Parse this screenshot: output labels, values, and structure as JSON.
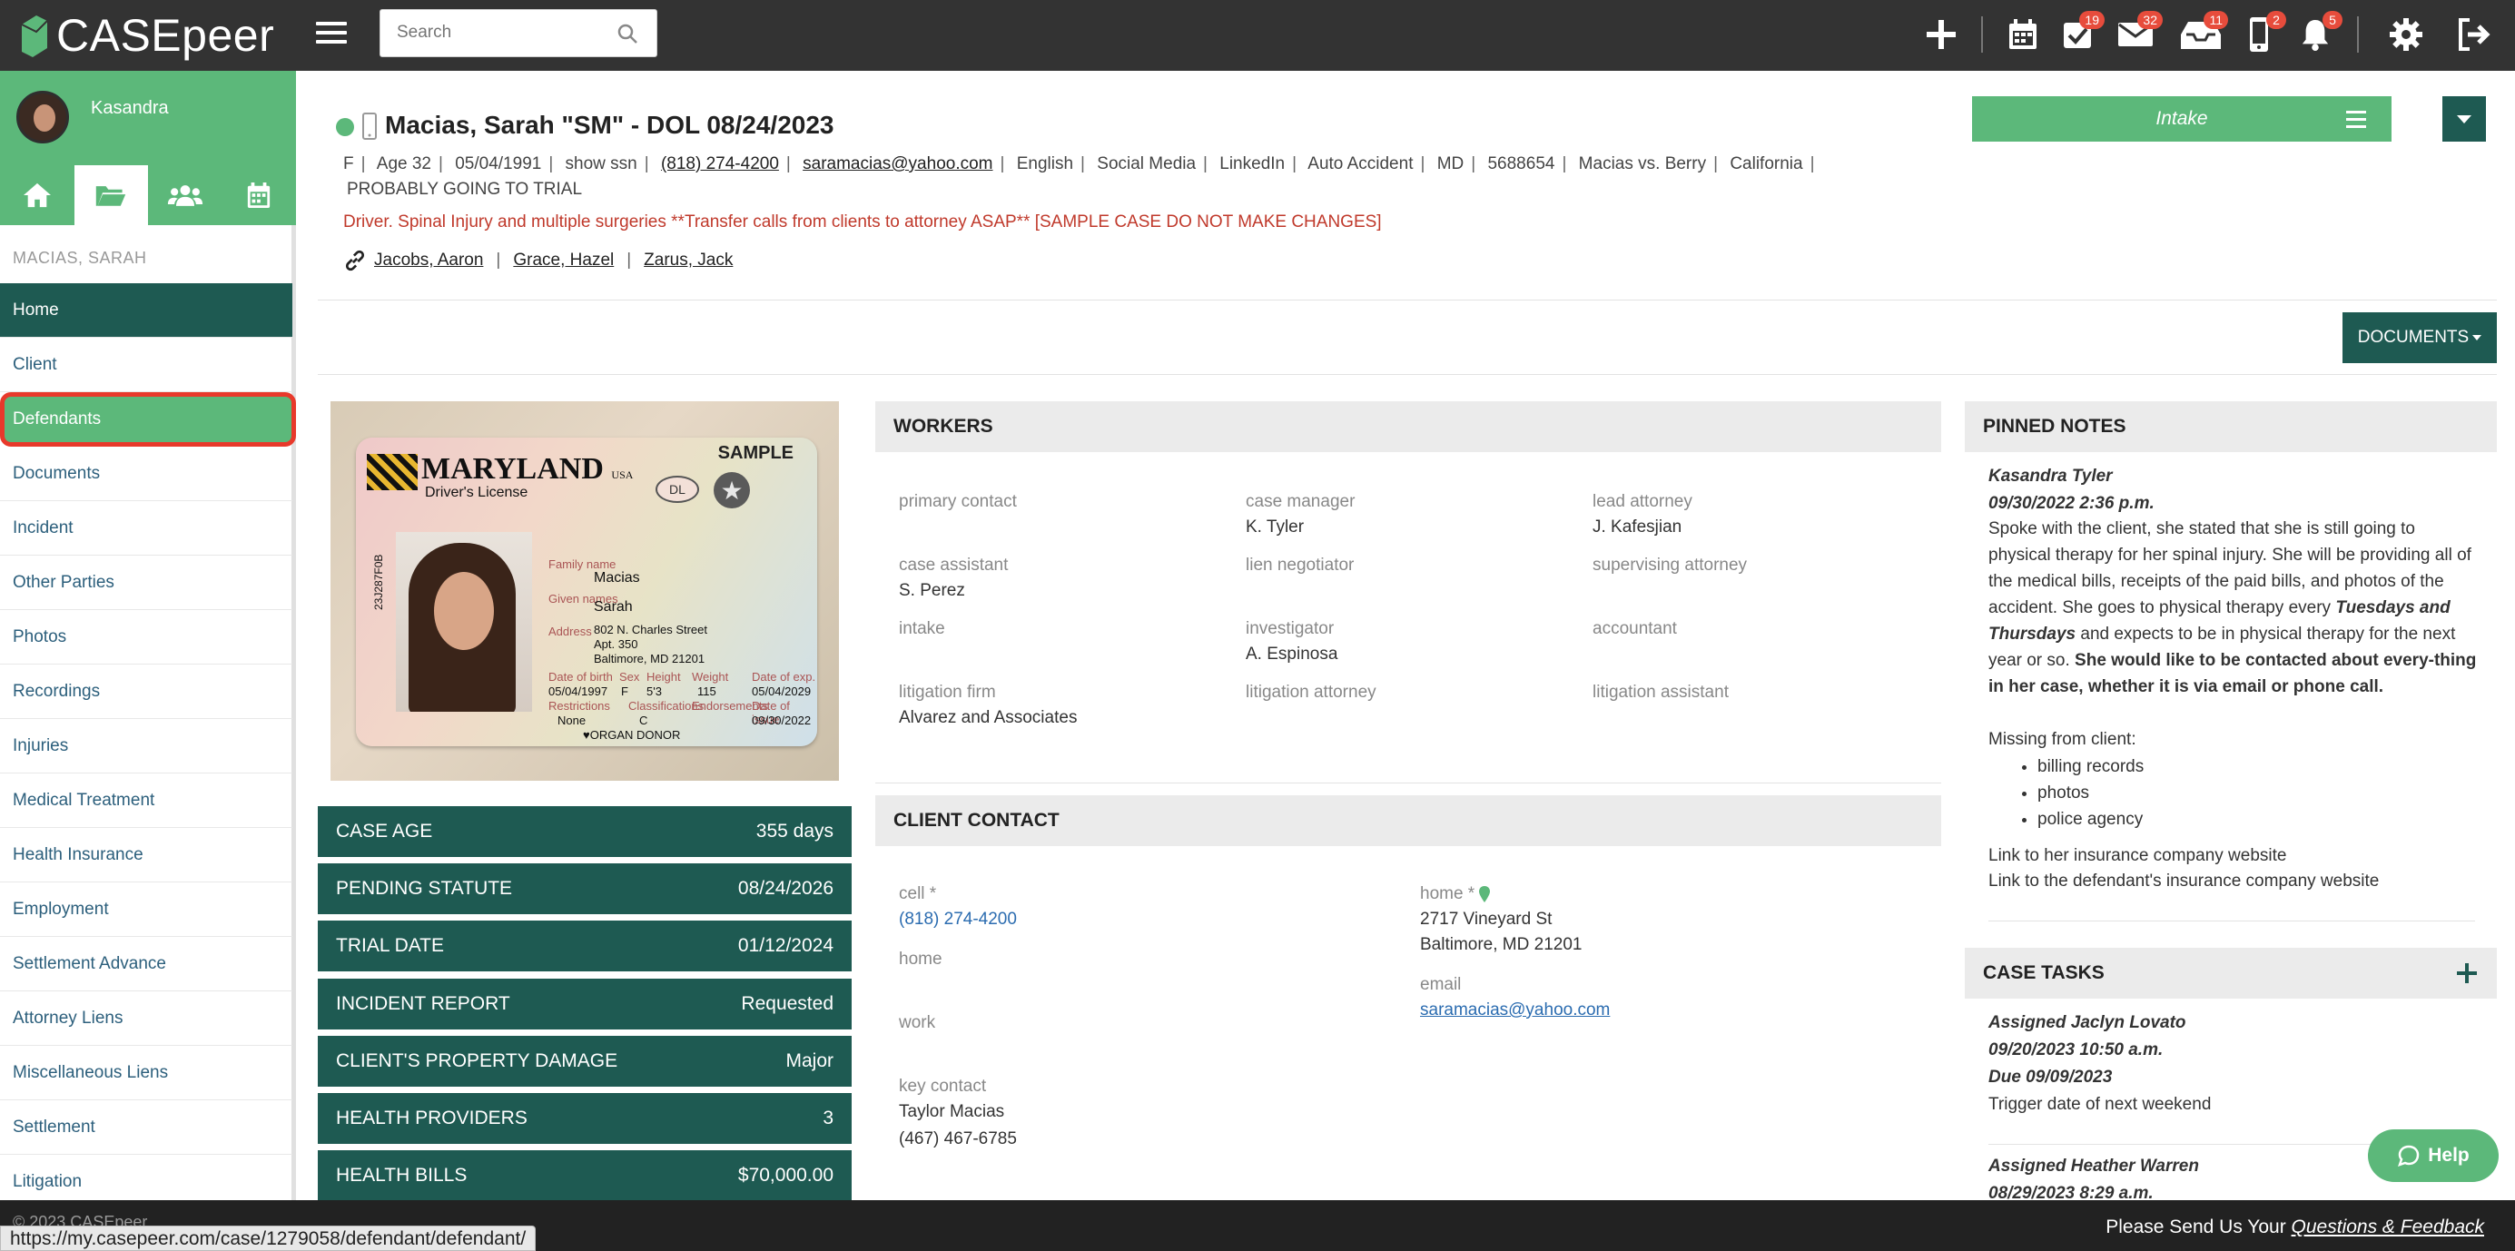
{
  "app": {
    "logo_text": "CASEpeer",
    "search_placeholder": "Search",
    "badges": {
      "tasks": "19",
      "mail": "32",
      "inbox": "11",
      "phone": "2",
      "bell": "5"
    }
  },
  "sidebar": {
    "username": "Kasandra",
    "case_name": "MACIAS, SARAH",
    "items": [
      {
        "label": "Home"
      },
      {
        "label": "Client"
      },
      {
        "label": "Defendants"
      },
      {
        "label": "Documents"
      },
      {
        "label": "Incident"
      },
      {
        "label": "Other Parties"
      },
      {
        "label": "Photos"
      },
      {
        "label": "Recordings"
      },
      {
        "label": "Injuries"
      },
      {
        "label": "Medical Treatment"
      },
      {
        "label": "Health Insurance"
      },
      {
        "label": "Employment"
      },
      {
        "label": "Settlement Advance"
      },
      {
        "label": "Attorney Liens"
      },
      {
        "label": "Miscellaneous Liens"
      },
      {
        "label": "Settlement"
      },
      {
        "label": "Litigation"
      }
    ]
  },
  "case": {
    "title": "Macias, Sarah \"SM\" - DOL 08/24/2023",
    "info": [
      "F",
      "Age 32",
      "05/04/1991",
      "show ssn",
      "(818) 274-4200",
      "saramacias@yahoo.com",
      "English",
      "Social Media",
      "LinkedIn",
      "Auto Accident",
      "MD",
      "5688654",
      "Macias vs. Berry",
      "California"
    ],
    "info2": "PROBABLY GOING TO TRIAL",
    "alert": "Driver. Spinal Injury and multiple surgeries **Transfer calls from clients to attorney ASAP** [SAMPLE CASE DO NOT MAKE CHANGES]",
    "related": [
      "Jacobs, Aaron",
      "Grace, Hazel",
      "Zarus, Jack"
    ],
    "phase_button": "Intake",
    "documents_button": "DOCUMENTS"
  },
  "license": {
    "state": "MARYLAND",
    "usa": "USA",
    "sub": "Driver's License",
    "sample": "SAMPLE",
    "dl": "DL",
    "number": "23J287F0B",
    "family_name_label": "Family name",
    "family_name": "Macias",
    "given_names_label": "Given names",
    "given_name": "Sarah",
    "address_label": "Address",
    "address1": "802 N. Charles Street",
    "address2": "Apt. 350",
    "address3": "Baltimore, MD 21201",
    "dob_label": "Date of birth",
    "dob": "05/04/1997",
    "sex_label": "Sex",
    "sex": "F",
    "height_label": "Height",
    "height": "5'3",
    "weight_label": "Weight",
    "weight": "115",
    "expiry_label": "Date of exp.",
    "expiry": "05/04/2029",
    "restrictions_label": "Restrictions",
    "restrictions": "None",
    "class_label": "Classifications",
    "class": "C",
    "endorse_label": "Endorsements",
    "issue_label": "Date of issue",
    "issue": "09/30/2022",
    "donor": "ORGAN DONOR"
  },
  "stats": [
    {
      "label": "CASE AGE",
      "value": "355 days"
    },
    {
      "label": "PENDING STATUTE",
      "value": "08/24/2026"
    },
    {
      "label": "TRIAL DATE",
      "value": "01/12/2024"
    },
    {
      "label": "INCIDENT REPORT",
      "value": "Requested"
    },
    {
      "label": "CLIENT'S PROPERTY DAMAGE",
      "value": "Major"
    },
    {
      "label": "HEALTH PROVIDERS",
      "value": "3"
    },
    {
      "label": "HEALTH BILLS",
      "value": "$70,000.00"
    }
  ],
  "workers": {
    "heading": "WORKERS",
    "items": [
      {
        "label": "primary contact",
        "value": ""
      },
      {
        "label": "case manager",
        "value": "K. Tyler"
      },
      {
        "label": "lead attorney",
        "value": "J. Kafesjian"
      },
      {
        "label": "case assistant",
        "value": "S. Perez"
      },
      {
        "label": "lien negotiator",
        "value": ""
      },
      {
        "label": "supervising attorney",
        "value": ""
      },
      {
        "label": "intake",
        "value": ""
      },
      {
        "label": "investigator",
        "value": "A. Espinosa"
      },
      {
        "label": "accountant",
        "value": ""
      },
      {
        "label": "litigation firm",
        "value": "Alvarez and Associates"
      },
      {
        "label": "litigation attorney",
        "value": ""
      },
      {
        "label": "litigation assistant",
        "value": ""
      }
    ]
  },
  "client_contact": {
    "heading": "CLIENT CONTACT",
    "cell_label": "cell *",
    "cell": "(818) 274-4200",
    "home_label": "home",
    "work_label": "work",
    "key_contact_label": "key contact",
    "key_contact_name": "Taylor Macias",
    "key_contact_phone": "(467) 467-6785",
    "home_addr_label": "home *",
    "home_addr1": "2717 Vineyard St",
    "home_addr2": "Baltimore, MD 21201",
    "email_label": "email",
    "email": "saramacias@yahoo.com"
  },
  "pinned_notes": {
    "heading": "PINNED NOTES",
    "author": "Kasandra Tyler",
    "date": "09/30/2022 2:36 p.m.",
    "body1": "Spoke with the client, she stated that she is still going to physical therapy for her spinal injury. She will be providing all of the medical bills, receipts of the paid bills, and photos of the accident. She goes to physical therapy every ",
    "body_italic": "Tuesdays and Thursdays",
    "body2": " and expects to be in physical therapy for the next year or so. ",
    "body_bold": "She would like to be contacted about every-thing in her case, whether it is via email or phone call.",
    "missing_label": "Missing from client:",
    "missing": [
      "billing records",
      "photos",
      "police agency"
    ],
    "link1": "Link to her insurance company website",
    "link2": "Link to the defendant's insurance company website"
  },
  "case_tasks": {
    "heading": "CASE TASKS",
    "task1_assigned": "Assigned Jaclyn Lovato",
    "task1_date": "09/20/2023 10:50 a.m.",
    "task1_due": "Due 09/09/2023",
    "task1_desc": "Trigger date of next weekend",
    "task2_assigned": "Assigned Heather Warren",
    "task2_date": "08/29/2023 8:29 a.m."
  },
  "help_label": "Help",
  "footer": {
    "copyright": "© 2023 CASEpeer",
    "prompt": "Please Send Us Your ",
    "link": "Questions & Feedback",
    "status_url": "https://my.casepeer.com/case/1279058/defendant/defendant/"
  }
}
